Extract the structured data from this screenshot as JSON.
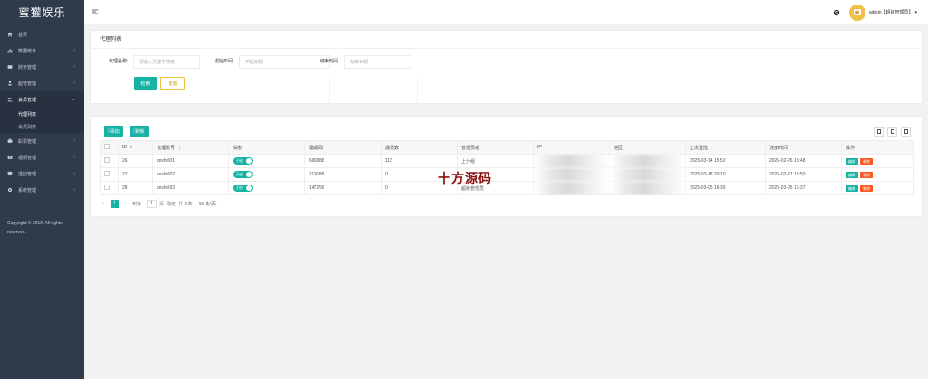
{
  "brand": "蜜獾娱乐",
  "sidebar": {
    "items": [
      {
        "label": "首页",
        "icon": "home-icon",
        "chevron": ""
      },
      {
        "label": "数据统计",
        "icon": "chart-icon",
        "chevron": "›"
      },
      {
        "label": "财务管理",
        "icon": "finance-icon",
        "chevron": "›"
      },
      {
        "label": "超管管理",
        "icon": "user-icon",
        "chevron": "›"
      },
      {
        "label": "会员管理",
        "icon": "users-icon",
        "chevron": "⌄"
      }
    ],
    "sub_items": [
      {
        "label": "代理列表"
      },
      {
        "label": "会员列表"
      }
    ],
    "items_after": [
      {
        "label": "彩票管理",
        "icon": "ticket-icon",
        "chevron": "›"
      },
      {
        "label": "视频管理",
        "icon": "video-icon",
        "chevron": "›"
      },
      {
        "label": "选妃管理",
        "icon": "heart-icon",
        "chevron": "›"
      },
      {
        "label": "系统管理",
        "icon": "gear-icon",
        "chevron": "›"
      }
    ],
    "copyright": "Copyright © 2019. All rights reserved."
  },
  "header": {
    "user": "admin【超级管理员】",
    "caret": "▾"
  },
  "search": {
    "title": "代理列表",
    "name_label": "代理名称:",
    "name_placeholder": "请输入关键字搜索",
    "start_label": "起始时间",
    "start_placeholder": "开始日期",
    "end_label": "结束时间",
    "end_placeholder": "结束日期",
    "search_btn": "检索",
    "reset_btn": "重置"
  },
  "toolbar": {
    "add": "添加",
    "refresh": "刷新"
  },
  "table": {
    "headers": [
      "",
      "ID",
      "代理账号",
      "状态",
      "邀请码",
      "成员数",
      "管理员组",
      "IP",
      "地区",
      "上次登陆",
      "注册时间",
      "操作"
    ],
    "switch_label": "开启",
    "edit_label": "编辑",
    "delete_label": "删除",
    "rows": [
      {
        "id": "26",
        "account": "ceshi001",
        "code": "666888",
        "members": "112",
        "group": "上分组",
        "last_login": "2025-03-14 15:52",
        "registered": "2025-02-26 13:48"
      },
      {
        "id": "27",
        "account": "ceshi002",
        "code": "116688",
        "members": "0",
        "group": "",
        "last_login": "2025-03-18 20:10",
        "registered": "2025-02-27 13:50"
      },
      {
        "id": "28",
        "account": "ceshi003",
        "code": "147258",
        "members": "0",
        "group": "超级管理员",
        "last_login": "2025-03-05 16:39",
        "registered": "2025-03-05 16:37"
      }
    ]
  },
  "pager": {
    "prev": "‹",
    "current": "1",
    "next": "›",
    "goto_label": "到第",
    "goto_value": "1",
    "page_unit": "页",
    "confirm": "确定",
    "total": "共 3 条",
    "page_size": "10 条/页",
    "page_size_caret": "⌄"
  },
  "watermark": "十方源码"
}
